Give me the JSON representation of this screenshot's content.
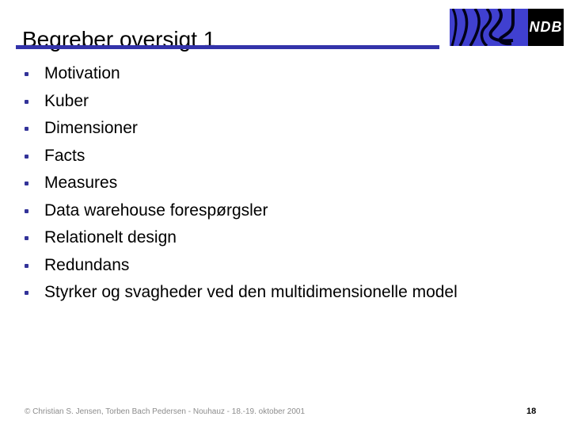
{
  "slide": {
    "title": "Begreber oversigt 1",
    "accent_color": "#3333aa",
    "bullet_color": "#333399",
    "logo": {
      "wave_bg": "#4040d0",
      "mark_bg": "#000000",
      "mark_text": "NDB"
    },
    "bullets": [
      {
        "label": "Motivation"
      },
      {
        "label": "Kuber"
      },
      {
        "label": "Dimensioner"
      },
      {
        "label": "Facts"
      },
      {
        "label": "Measures"
      },
      {
        "label": "Data warehouse forespørgsler"
      },
      {
        "label": "Relationelt design"
      },
      {
        "label": "Redundans"
      },
      {
        "label": "Styrker og svagheder ved den multidimensionelle model"
      }
    ],
    "footer": {
      "credit": "© Christian S. Jensen, Torben Bach Pedersen - Nouhauz - 18.-19. oktober 2001",
      "page_number": "18"
    }
  }
}
